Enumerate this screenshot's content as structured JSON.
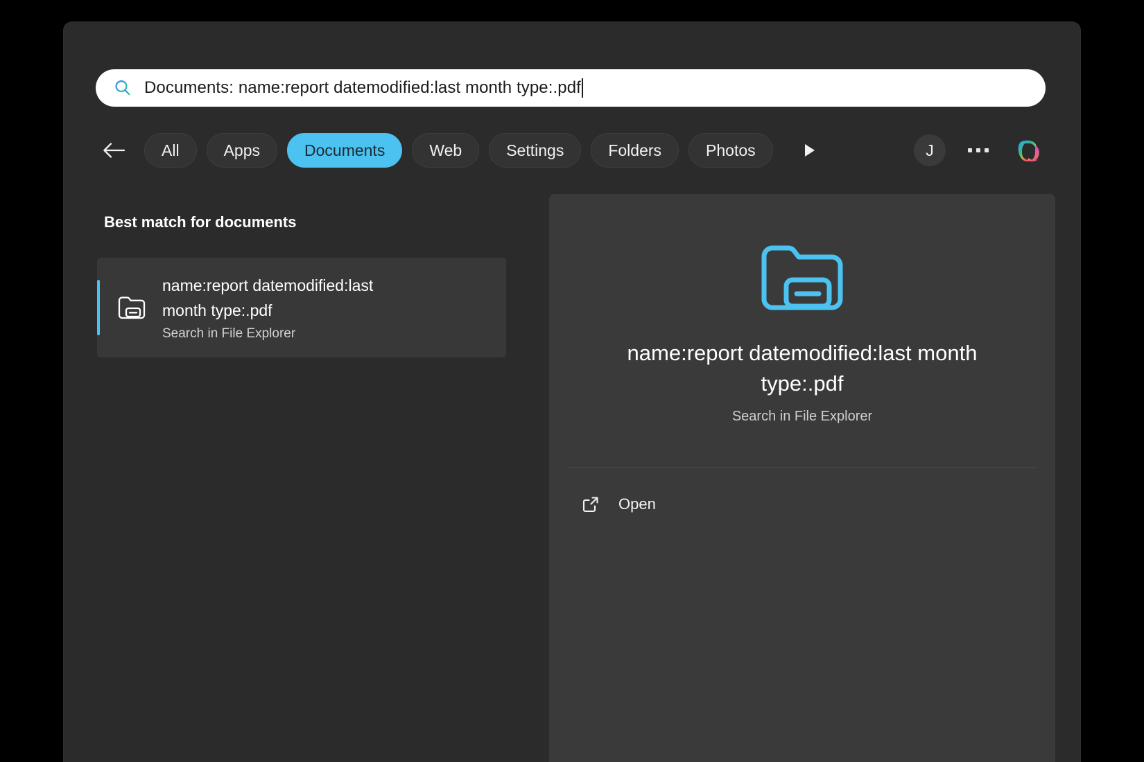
{
  "window": {
    "title": "Windows Search"
  },
  "search": {
    "icon": "search-icon",
    "value": "Documents: name:report datemodified:last month type:.pdf",
    "placeholder": "Type here to search",
    "caret": true
  },
  "tabs": {
    "back_icon": "arrow-left-icon",
    "overflow_icon": "chevron-right-icon",
    "items": [
      {
        "label": "All",
        "selected": false
      },
      {
        "label": "Apps",
        "selected": false
      },
      {
        "label": "Documents",
        "selected": true
      },
      {
        "label": "Web",
        "selected": false
      },
      {
        "label": "Settings",
        "selected": false
      },
      {
        "label": "Folders",
        "selected": false
      },
      {
        "label": "Photos",
        "selected": false
      }
    ],
    "account_initial": "J",
    "more_icon": "ellipsis-icon",
    "copilot_icon": "copilot-icon"
  },
  "results": {
    "header": "Best match for documents",
    "item": {
      "icon": "folder-search-icon",
      "title": "name:report datemodified:last month type:.pdf",
      "subtitle": "Search in File Explorer",
      "selected": true
    }
  },
  "preview": {
    "icon": "folder-search-icon",
    "title": "name:report datemodified:last month type:.pdf",
    "subtitle": "Search in File Explorer",
    "actions": [
      {
        "label": "Open",
        "icon": "open-external-icon"
      }
    ]
  },
  "colors": {
    "accent": "#4cc2f1",
    "selected_tab_bg": "#4cc2f1",
    "window_bg": "#2b2b2b",
    "preview_bg": "#3a3a3a",
    "result_selected_bg": "#383838",
    "search_box_bg": "#ffffff"
  }
}
